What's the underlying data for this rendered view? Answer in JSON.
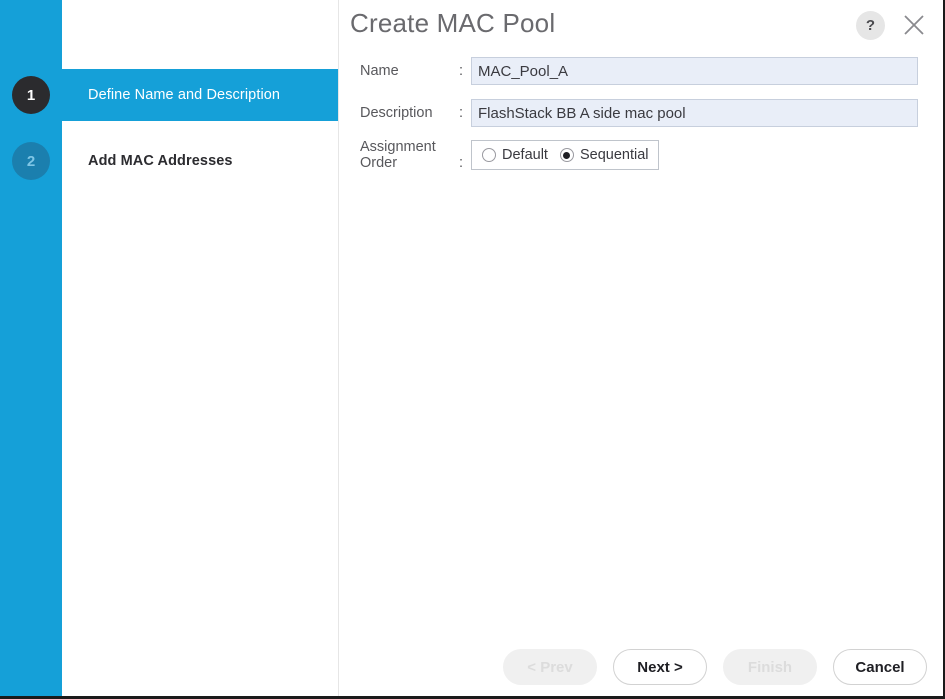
{
  "dialog": {
    "title": "Create MAC Pool",
    "help_icon": "question-mark-icon",
    "close_icon": "close-icon",
    "accent_color": "#15a0d8",
    "active_step_circle_color": "#2b2b2e",
    "inactive_step_circle_color": "#1b7fae"
  },
  "sidebar": {
    "steps": [
      {
        "number": "1",
        "label": "Define Name and Description",
        "state": "active"
      },
      {
        "number": "2",
        "label": "Add MAC Addresses",
        "state": "inactive"
      }
    ]
  },
  "form": {
    "name": {
      "label": "Name",
      "colon": ":",
      "value": "MAC_Pool_A",
      "placeholder": ""
    },
    "description": {
      "label": "Description",
      "colon": ":",
      "value": "FlashStack BB A side mac pool",
      "placeholder": ""
    },
    "assignment_order": {
      "label": "Assignment Order",
      "colon": ":",
      "selected": "Sequential",
      "options": [
        {
          "label": "Default",
          "selected": false
        },
        {
          "label": "Sequential",
          "selected": true
        }
      ]
    }
  },
  "footer": {
    "buttons": [
      {
        "label": "< Prev",
        "state": "disabled"
      },
      {
        "label": "Next >",
        "state": "enabled"
      },
      {
        "label": "Finish",
        "state": "disabled"
      },
      {
        "label": "Cancel",
        "state": "enabled"
      }
    ]
  }
}
